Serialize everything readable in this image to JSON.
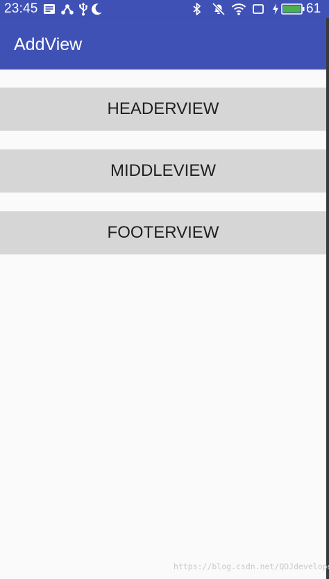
{
  "status_bar": {
    "time": "23:45",
    "battery_level": "61",
    "icons": [
      "notification-icon",
      "share-icon",
      "usb-icon",
      "moon-icon",
      "bluetooth-icon",
      "mute-icon",
      "wifi-icon",
      "screen-icon",
      "charging-icon",
      "battery-icon"
    ],
    "background_color": "#3f51b5",
    "battery_color": "#4caf50"
  },
  "toolbar": {
    "title": "AddView",
    "background_color": "#3f51b5"
  },
  "views": [
    {
      "label": "HEADERVIEW"
    },
    {
      "label": "MIDDLEVIEW"
    },
    {
      "label": "FOOTERVIEW"
    }
  ],
  "watermark": "https://blog.csdn.net/QDJdeveloper"
}
